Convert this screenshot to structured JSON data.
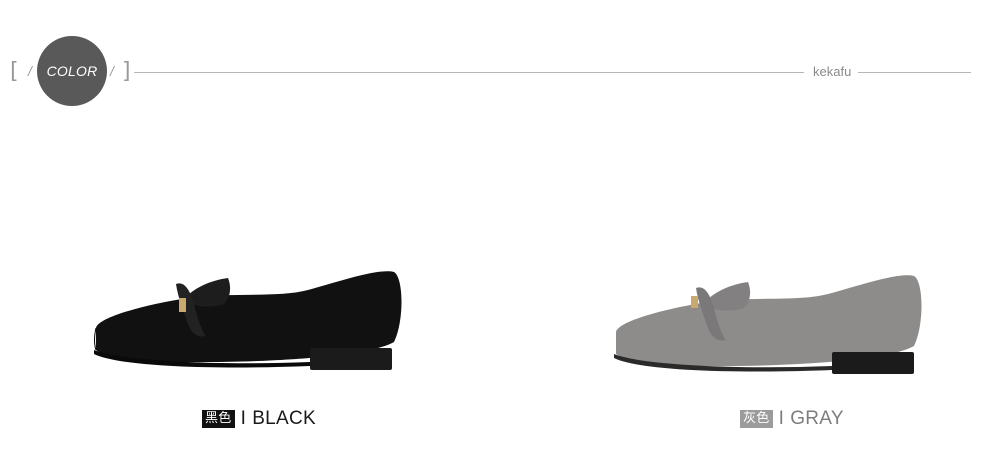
{
  "header": {
    "color_label": "COLOR",
    "brand": "kekafu"
  },
  "variants": [
    {
      "badge": "黑色",
      "separator": "I",
      "name": "BLACK",
      "badge_color": "#111111",
      "text_color": "#1a1a1a",
      "shoe_color": "#111111"
    },
    {
      "badge": "灰色",
      "separator": "I",
      "name": "GRAY",
      "badge_color": "#9b9b9b",
      "text_color": "#7d7d7d",
      "shoe_color": "#8e8b8b"
    }
  ]
}
